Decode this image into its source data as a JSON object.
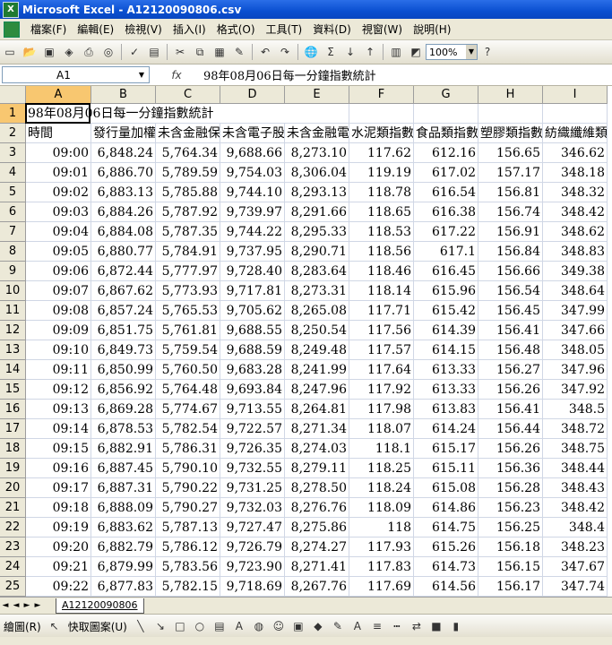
{
  "window": {
    "title": "Microsoft Excel - A12120090806.csv"
  },
  "menu": [
    "檔案(F)",
    "編輯(E)",
    "檢視(V)",
    "插入(I)",
    "格式(O)",
    "工具(T)",
    "資料(D)",
    "視窗(W)",
    "說明(H)"
  ],
  "toolbar": {
    "zoom": "100%"
  },
  "formula_bar": {
    "cell_ref": "A1",
    "fx": "fx",
    "content": "98年08月06日每一分鐘指數統計"
  },
  "columns": [
    "A",
    "B",
    "C",
    "D",
    "E",
    "F",
    "G",
    "H",
    "I"
  ],
  "row_numbers": [
    "1",
    "2",
    "3",
    "4",
    "5",
    "6",
    "7",
    "8",
    "9",
    "10",
    "11",
    "12",
    "13",
    "14",
    "15",
    "16",
    "17",
    "18",
    "19",
    "20",
    "21",
    "22",
    "23",
    "24",
    "25"
  ],
  "sheet": {
    "title_cell": "98年08月06日每一分鐘指數統計",
    "headers": [
      "時間",
      "發行量加權",
      "未含金融保",
      "未含電子股",
      "未含金融電",
      "水泥類指數",
      "食品類指數",
      "塑膠類指數",
      "紡織纖維類"
    ],
    "rows": [
      [
        "09:00",
        "6,848.24",
        "5,764.34",
        "9,688.66",
        "8,273.10",
        "117.62",
        "612.16",
        "156.65",
        "346.62"
      ],
      [
        "09:01",
        "6,886.70",
        "5,789.59",
        "9,754.03",
        "8,306.04",
        "119.19",
        "617.02",
        "157.17",
        "348.18"
      ],
      [
        "09:02",
        "6,883.13",
        "5,785.88",
        "9,744.10",
        "8,293.13",
        "118.78",
        "616.54",
        "156.81",
        "348.32"
      ],
      [
        "09:03",
        "6,884.26",
        "5,787.92",
        "9,739.97",
        "8,291.66",
        "118.65",
        "616.38",
        "156.74",
        "348.42"
      ],
      [
        "09:04",
        "6,884.08",
        "5,787.35",
        "9,744.22",
        "8,295.33",
        "118.53",
        "617.22",
        "156.91",
        "348.62"
      ],
      [
        "09:05",
        "6,880.77",
        "5,784.91",
        "9,737.95",
        "8,290.71",
        "118.56",
        "617.1",
        "156.84",
        "348.83"
      ],
      [
        "09:06",
        "6,872.44",
        "5,777.97",
        "9,728.40",
        "8,283.64",
        "118.46",
        "616.45",
        "156.66",
        "349.38"
      ],
      [
        "09:07",
        "6,867.62",
        "5,773.93",
        "9,717.81",
        "8,273.31",
        "118.14",
        "615.96",
        "156.54",
        "348.64"
      ],
      [
        "09:08",
        "6,857.24",
        "5,765.53",
        "9,705.62",
        "8,265.08",
        "117.71",
        "615.42",
        "156.45",
        "347.99"
      ],
      [
        "09:09",
        "6,851.75",
        "5,761.81",
        "9,688.55",
        "8,250.54",
        "117.56",
        "614.39",
        "156.41",
        "347.66"
      ],
      [
        "09:10",
        "6,849.73",
        "5,759.54",
        "9,688.59",
        "8,249.48",
        "117.57",
        "614.15",
        "156.48",
        "348.05"
      ],
      [
        "09:11",
        "6,850.99",
        "5,760.50",
        "9,683.28",
        "8,241.99",
        "117.64",
        "613.33",
        "156.27",
        "347.96"
      ],
      [
        "09:12",
        "6,856.92",
        "5,764.48",
        "9,693.84",
        "8,247.96",
        "117.92",
        "613.33",
        "156.26",
        "347.92"
      ],
      [
        "09:13",
        "6,869.28",
        "5,774.67",
        "9,713.55",
        "8,264.81",
        "117.98",
        "613.83",
        "156.41",
        "348.5"
      ],
      [
        "09:14",
        "6,878.53",
        "5,782.54",
        "9,722.57",
        "8,271.34",
        "118.07",
        "614.24",
        "156.44",
        "348.72"
      ],
      [
        "09:15",
        "6,882.91",
        "5,786.31",
        "9,726.35",
        "8,274.03",
        "118.1",
        "615.17",
        "156.26",
        "348.75"
      ],
      [
        "09:16",
        "6,887.45",
        "5,790.10",
        "9,732.55",
        "8,279.11",
        "118.25",
        "615.11",
        "156.36",
        "348.44"
      ],
      [
        "09:17",
        "6,887.31",
        "5,790.22",
        "9,731.25",
        "8,278.50",
        "118.24",
        "615.08",
        "156.28",
        "348.43"
      ],
      [
        "09:18",
        "6,888.09",
        "5,790.27",
        "9,732.03",
        "8,276.76",
        "118.09",
        "614.86",
        "156.23",
        "348.42"
      ],
      [
        "09:19",
        "6,883.62",
        "5,787.13",
        "9,727.47",
        "8,275.86",
        "118",
        "614.75",
        "156.25",
        "348.4"
      ],
      [
        "09:20",
        "6,882.79",
        "5,786.12",
        "9,726.79",
        "8,274.27",
        "117.93",
        "615.26",
        "156.18",
        "348.23"
      ],
      [
        "09:21",
        "6,879.99",
        "5,783.56",
        "9,723.90",
        "8,271.41",
        "117.83",
        "614.73",
        "156.15",
        "347.67"
      ],
      [
        "09:22",
        "6,877.83",
        "5,782.15",
        "9,718.69",
        "8,267.76",
        "117.69",
        "614.56",
        "156.17",
        "347.74"
      ]
    ]
  },
  "sheet_tab": "A12120090806",
  "drawing_toolbar": {
    "draw_label": "繪圖(R)",
    "autoshapes_label": "快取圖案(U)"
  }
}
